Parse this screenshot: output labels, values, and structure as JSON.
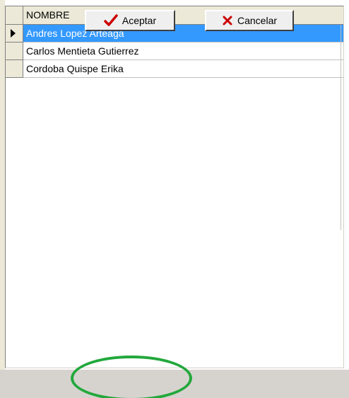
{
  "grid": {
    "columns": [
      "NOMBRE"
    ],
    "rows": [
      {
        "nombre": "Andres Lopez Arteaga",
        "selected": true
      },
      {
        "nombre": "Carlos Mentieta Gutierrez",
        "selected": false
      },
      {
        "nombre": "Cordoba Quispe Erika",
        "selected": false
      }
    ]
  },
  "buttons": {
    "accept_label": "Aceptar",
    "cancel_label": "Cancelar"
  },
  "icons": {
    "accept": "check-icon",
    "cancel": "x-icon",
    "row_indicator": "row-pointer-icon"
  },
  "colors": {
    "selection": "#3399ff",
    "accept_check": "#cc0000",
    "cancel_x": "#cc0000",
    "highlight_ring": "#22a83c"
  }
}
